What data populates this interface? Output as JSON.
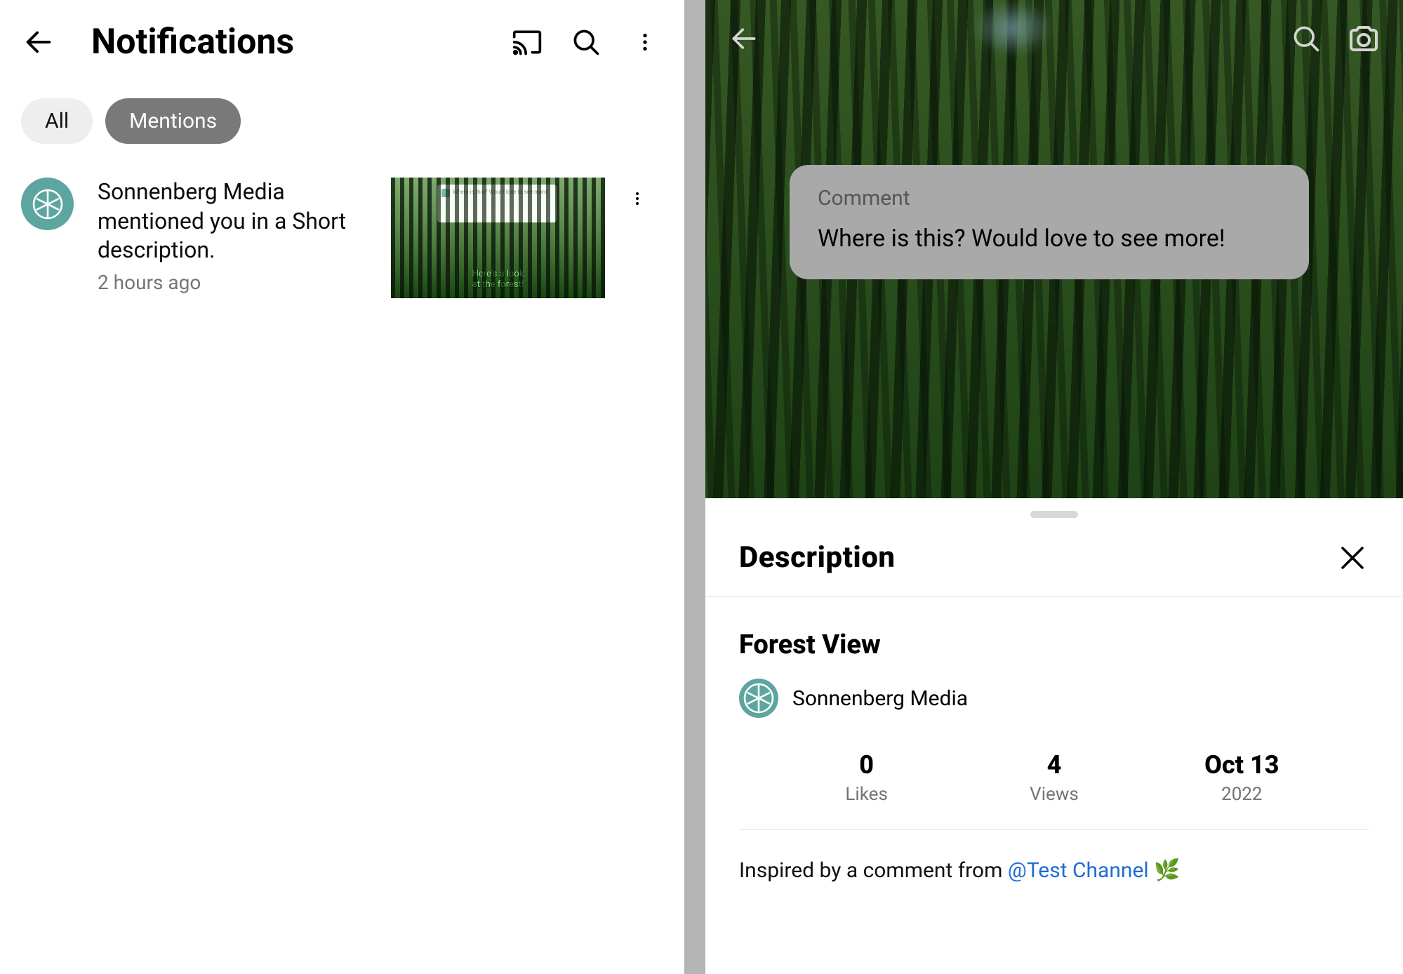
{
  "notifications": {
    "title": "Notifications",
    "chips": {
      "all": "All",
      "mentions": "Mentions"
    },
    "item": {
      "text": "Sonnenberg Media mentioned you in a Short description.",
      "time": "2 hours ago",
      "thumb_tiny": "Where is this? Would love to see more!",
      "thumb_caption_l1": "Here's a look",
      "thumb_caption_l2": "at the forest!"
    }
  },
  "short": {
    "comment_label": "Comment",
    "comment_text": "Where is this? Would love to see more!"
  },
  "sheet": {
    "title": "Description",
    "video_title": "Forest View",
    "channel": "Sonnenberg Media",
    "stats": {
      "likes_v": "0",
      "likes_l": "Likes",
      "views_v": "4",
      "views_l": "Views",
      "date_v": "Oct 13",
      "date_l": "2022"
    },
    "body_prefix": "Inspired by a comment from ",
    "body_mention": "@Test Channel",
    "body_emoji": " 🌿"
  }
}
